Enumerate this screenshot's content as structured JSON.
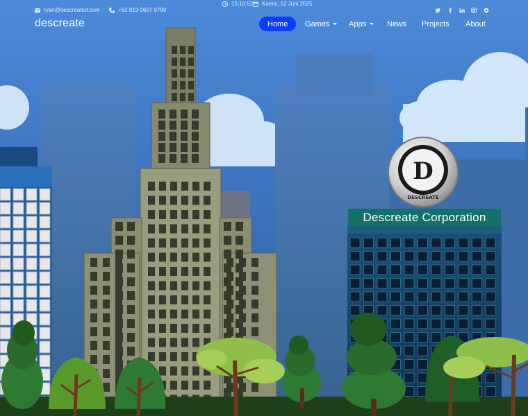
{
  "topbar": {
    "email": "ryan@descreated.com",
    "phone": "+62 819 0607 9799",
    "time": "15:16:52",
    "date": "Kamis, 12 Juni 2025",
    "social": [
      "twitter-icon",
      "facebook-icon",
      "linkedin-icon",
      "instagram-icon",
      "skype-icon"
    ]
  },
  "brand": "descreate",
  "nav": {
    "home": "Home",
    "games": "Games",
    "apps": "Apps",
    "news": "News",
    "projects": "Projects",
    "about": "About"
  },
  "hero": {
    "logo_letter": "D",
    "logo_text": "DESCREATE",
    "sign": "Descreate Corporation"
  },
  "colors": {
    "nav_active": "#0a3bff",
    "sky": "#4a86d6",
    "sign": "#14706a",
    "ground": "#1f3f1a"
  }
}
